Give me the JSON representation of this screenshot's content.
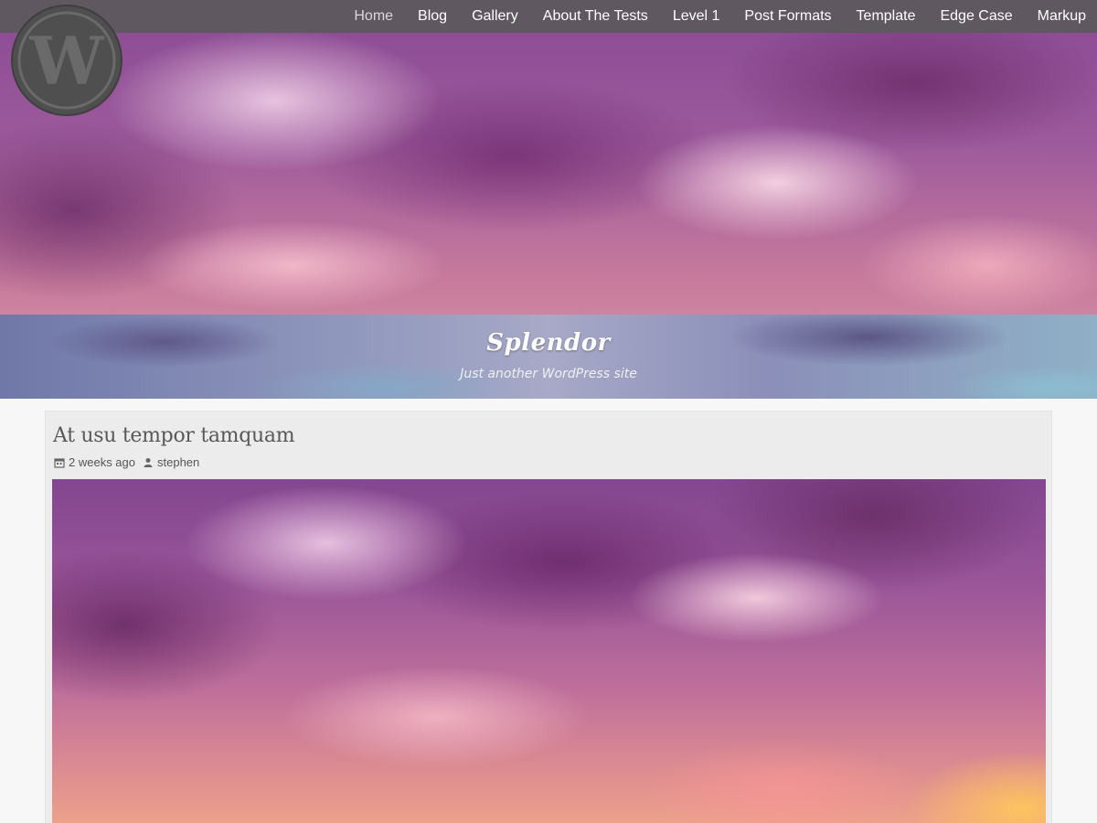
{
  "site": {
    "title": "Splendor",
    "tagline": "Just another WordPress site",
    "logo_icon": "wordpress-logo-icon"
  },
  "nav": {
    "items": [
      {
        "label": "Home",
        "active": true
      },
      {
        "label": "Blog"
      },
      {
        "label": "Gallery"
      },
      {
        "label": "About The Tests"
      },
      {
        "label": "Level 1"
      },
      {
        "label": "Post Formats"
      },
      {
        "label": "Template"
      },
      {
        "label": "Edge Case"
      },
      {
        "label": "Markup"
      }
    ]
  },
  "post": {
    "title": "At usu tempor tamquam",
    "date": "2 weeks ago",
    "author": "stephen",
    "date_icon": "calendar-icon",
    "author_icon": "user-icon"
  },
  "colors": {
    "navbar": "#5a5a5a",
    "page_background": "#f7f7f7",
    "post_background": "#ececec",
    "title_text": "#585858"
  }
}
